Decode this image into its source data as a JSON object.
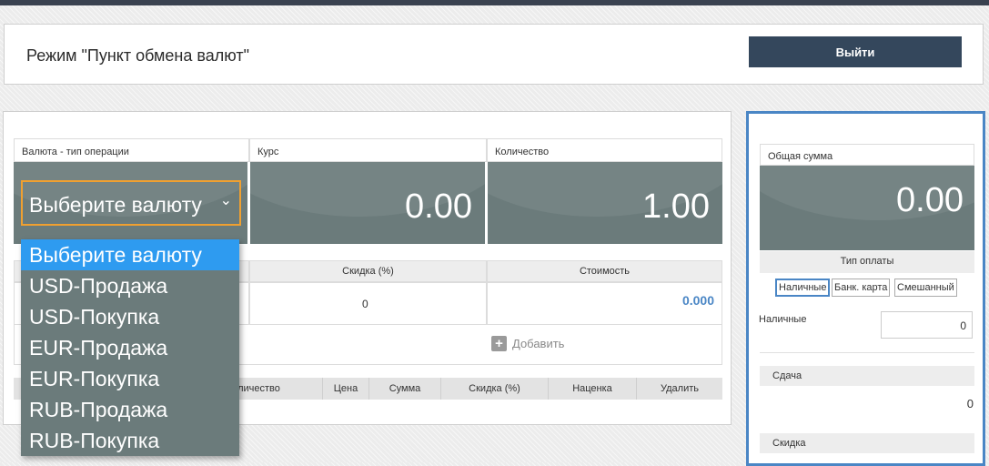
{
  "header": {
    "mode_title": "Режим \"Пункт обмена валют\"",
    "logout_label": "Выйти"
  },
  "form": {
    "currency_header": "Валюта - тип операции",
    "rate_header": "Курс",
    "quantity_header": "Количество",
    "select_value": "Выберите валюту",
    "rate_value": "0.00",
    "quantity_value": "1.00",
    "discount_header": "Скидка (%)",
    "cost_header": "Стоимость",
    "discount_value": "0",
    "cost_value": "0.000",
    "add_label": "Добавить"
  },
  "table": {
    "columns": [
      "личество",
      "Цена",
      "Сумма",
      "Скидка (%)",
      "Наценка",
      "Удалить"
    ]
  },
  "dropdown": {
    "options": [
      "Выберите валюту",
      "USD-Продажа",
      "USD-Покупка",
      "EUR-Продажа",
      "EUR-Покупка",
      "RUB-Продажа",
      "RUB-Покупка"
    ]
  },
  "summary": {
    "total_header": "Общая сумма",
    "total_value": "0.00",
    "payment_type_title": "Тип оплаты",
    "payment_buttons": [
      "Наличные",
      "Банк. карта",
      "Смешанный"
    ],
    "cash_label": "Наличные",
    "cash_value": "0",
    "change_label": "Сдача",
    "change_value": "0",
    "discount_label": "Скидка"
  },
  "colors": {
    "accent": "#4a86c5",
    "dark_cell": "#6b7b7b",
    "button": "#34475c",
    "focus": "#f0a030",
    "selected_option": "#2e9bf0"
  }
}
